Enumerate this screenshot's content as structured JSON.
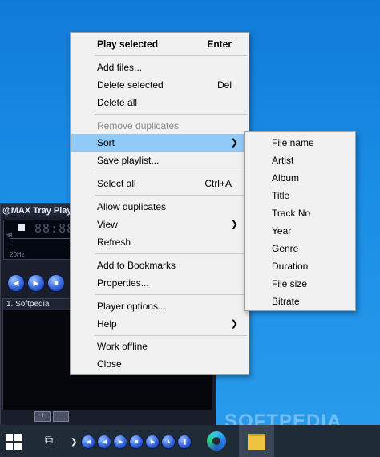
{
  "player": {
    "title": "@MAX Tray Player",
    "time_digits": "88:88",
    "db_label": "dB",
    "hz_label": "20Hz",
    "playlist": [
      "1.  Softpedia"
    ],
    "playlist_buttons": [
      "+",
      "−"
    ]
  },
  "menu": {
    "items": [
      {
        "label": "Play selected",
        "shortcut": "Enter",
        "bold": true
      },
      {
        "label": "Add files..."
      },
      {
        "label": "Delete selected",
        "shortcut": "Del"
      },
      {
        "label": "Delete all"
      },
      {
        "label": "Remove duplicates",
        "disabled": true
      },
      {
        "label": "Sort",
        "submenu": true,
        "highlighted": true
      },
      {
        "label": "Save playlist..."
      },
      {
        "label": "Select all",
        "shortcut": "Ctrl+A"
      },
      {
        "label": "Allow duplicates"
      },
      {
        "label": "View",
        "submenu": true
      },
      {
        "label": "Refresh"
      },
      {
        "label": "Add to Bookmarks"
      },
      {
        "label": "Properties..."
      },
      {
        "label": "Player options..."
      },
      {
        "label": "Help",
        "submenu": true
      },
      {
        "label": "Work offline"
      },
      {
        "label": "Close"
      }
    ]
  },
  "sort_submenu": {
    "items": [
      "File name",
      "Artist",
      "Album",
      "Title",
      "Track No",
      "Year",
      "Genre",
      "Duration",
      "File size",
      "Bitrate"
    ]
  },
  "taskbar": {
    "icons": [
      "windows-start-icon",
      "task-view-icon",
      "player-controls",
      "edge-icon",
      "file-explorer-icon"
    ]
  },
  "watermark": "SOFTPEDIA",
  "colors": {
    "desktop": "#1b8fe6",
    "menu_bg": "#f1f1f1",
    "menu_highlight": "#91c9f7",
    "taskbar": "#202b38"
  }
}
